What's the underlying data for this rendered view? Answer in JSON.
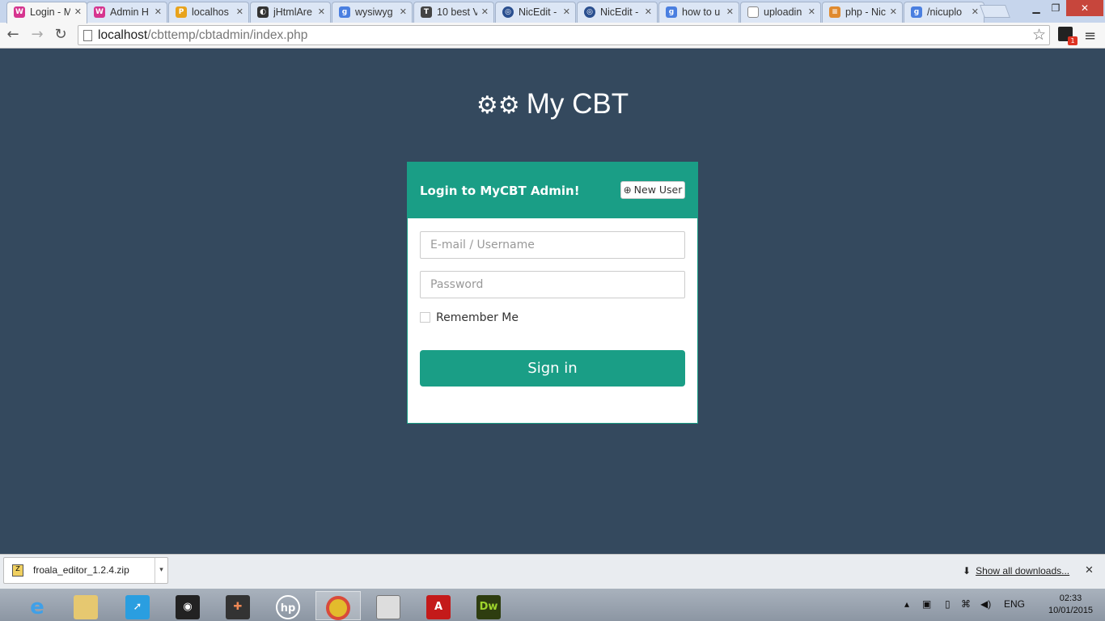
{
  "browser": {
    "tabs": [
      {
        "label": "Login - M",
        "icon": "wamp-icon",
        "color": "#d6358f"
      },
      {
        "label": "Admin H",
        "icon": "wamp-icon",
        "color": "#d6358f"
      },
      {
        "label": "localhos",
        "icon": "pma-icon",
        "color": "#e8a31c"
      },
      {
        "label": "jHtmlAre",
        "icon": "github-icon",
        "color": "#333333"
      },
      {
        "label": "wysiwyg",
        "icon": "google-icon",
        "color": "#4a7fe0"
      },
      {
        "label": "10 best V",
        "icon": "t-icon",
        "color": "#444444"
      },
      {
        "label": "NicEdit -",
        "icon": "globe-icon",
        "color": "#2a4f8f"
      },
      {
        "label": "NicEdit -",
        "icon": "globe-icon",
        "color": "#2a4f8f"
      },
      {
        "label": "how to u",
        "icon": "google-icon",
        "color": "#4a7fe0"
      },
      {
        "label": "uploadin",
        "icon": "page-icon",
        "color": "#888888"
      },
      {
        "label": "php - Nic",
        "icon": "stackoverflow-icon",
        "color": "#e08a2e"
      },
      {
        "label": "/nicuplo",
        "icon": "google-icon",
        "color": "#4a7fe0"
      }
    ],
    "url_host": "localhost",
    "url_path": "/cbttemp/cbtadmin/index.php",
    "ext_badge": "1"
  },
  "page": {
    "brand": "My CBT",
    "login_title": "Login to MyCBT Admin!",
    "new_user_label": "New User",
    "email_placeholder": "E-mail / Username",
    "password_placeholder": "Password",
    "remember_label": "Remember Me",
    "signin_label": "Sign in",
    "accent_color": "#1a9e86",
    "background_color": "#34495e"
  },
  "downloads": {
    "file_name": "froala_editor_1.2.4.zip",
    "show_all_label": "Show all downloads..."
  },
  "taskbar": {
    "apps": [
      "ie-icon",
      "explorer-icon",
      "rocket-icon",
      "camera-icon",
      "puzzle-icon",
      "hp-icon",
      "chrome-icon",
      "window-icon",
      "acrobat-icon",
      "dreamweaver-icon"
    ],
    "language": "ENG",
    "time": "02:33",
    "date": "10/01/2015"
  }
}
